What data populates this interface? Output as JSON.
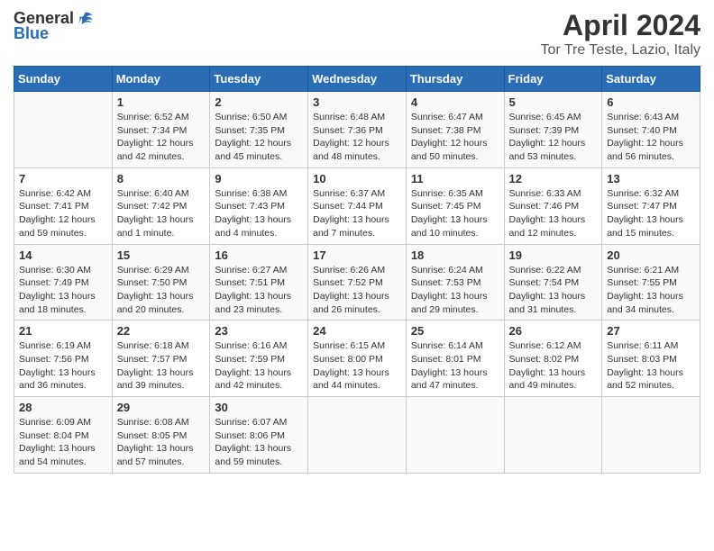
{
  "logo": {
    "general": "General",
    "blue": "Blue"
  },
  "title": "April 2024",
  "subtitle": "Tor Tre Teste, Lazio, Italy",
  "days_header": [
    "Sunday",
    "Monday",
    "Tuesday",
    "Wednesday",
    "Thursday",
    "Friday",
    "Saturday"
  ],
  "weeks": [
    [
      {
        "day": "",
        "info": ""
      },
      {
        "day": "1",
        "info": "Sunrise: 6:52 AM\nSunset: 7:34 PM\nDaylight: 12 hours\nand 42 minutes."
      },
      {
        "day": "2",
        "info": "Sunrise: 6:50 AM\nSunset: 7:35 PM\nDaylight: 12 hours\nand 45 minutes."
      },
      {
        "day": "3",
        "info": "Sunrise: 6:48 AM\nSunset: 7:36 PM\nDaylight: 12 hours\nand 48 minutes."
      },
      {
        "day": "4",
        "info": "Sunrise: 6:47 AM\nSunset: 7:38 PM\nDaylight: 12 hours\nand 50 minutes."
      },
      {
        "day": "5",
        "info": "Sunrise: 6:45 AM\nSunset: 7:39 PM\nDaylight: 12 hours\nand 53 minutes."
      },
      {
        "day": "6",
        "info": "Sunrise: 6:43 AM\nSunset: 7:40 PM\nDaylight: 12 hours\nand 56 minutes."
      }
    ],
    [
      {
        "day": "7",
        "info": "Sunrise: 6:42 AM\nSunset: 7:41 PM\nDaylight: 12 hours\nand 59 minutes."
      },
      {
        "day": "8",
        "info": "Sunrise: 6:40 AM\nSunset: 7:42 PM\nDaylight: 13 hours\nand 1 minute."
      },
      {
        "day": "9",
        "info": "Sunrise: 6:38 AM\nSunset: 7:43 PM\nDaylight: 13 hours\nand 4 minutes."
      },
      {
        "day": "10",
        "info": "Sunrise: 6:37 AM\nSunset: 7:44 PM\nDaylight: 13 hours\nand 7 minutes."
      },
      {
        "day": "11",
        "info": "Sunrise: 6:35 AM\nSunset: 7:45 PM\nDaylight: 13 hours\nand 10 minutes."
      },
      {
        "day": "12",
        "info": "Sunrise: 6:33 AM\nSunset: 7:46 PM\nDaylight: 13 hours\nand 12 minutes."
      },
      {
        "day": "13",
        "info": "Sunrise: 6:32 AM\nSunset: 7:47 PM\nDaylight: 13 hours\nand 15 minutes."
      }
    ],
    [
      {
        "day": "14",
        "info": "Sunrise: 6:30 AM\nSunset: 7:49 PM\nDaylight: 13 hours\nand 18 minutes."
      },
      {
        "day": "15",
        "info": "Sunrise: 6:29 AM\nSunset: 7:50 PM\nDaylight: 13 hours\nand 20 minutes."
      },
      {
        "day": "16",
        "info": "Sunrise: 6:27 AM\nSunset: 7:51 PM\nDaylight: 13 hours\nand 23 minutes."
      },
      {
        "day": "17",
        "info": "Sunrise: 6:26 AM\nSunset: 7:52 PM\nDaylight: 13 hours\nand 26 minutes."
      },
      {
        "day": "18",
        "info": "Sunrise: 6:24 AM\nSunset: 7:53 PM\nDaylight: 13 hours\nand 29 minutes."
      },
      {
        "day": "19",
        "info": "Sunrise: 6:22 AM\nSunset: 7:54 PM\nDaylight: 13 hours\nand 31 minutes."
      },
      {
        "day": "20",
        "info": "Sunrise: 6:21 AM\nSunset: 7:55 PM\nDaylight: 13 hours\nand 34 minutes."
      }
    ],
    [
      {
        "day": "21",
        "info": "Sunrise: 6:19 AM\nSunset: 7:56 PM\nDaylight: 13 hours\nand 36 minutes."
      },
      {
        "day": "22",
        "info": "Sunrise: 6:18 AM\nSunset: 7:57 PM\nDaylight: 13 hours\nand 39 minutes."
      },
      {
        "day": "23",
        "info": "Sunrise: 6:16 AM\nSunset: 7:59 PM\nDaylight: 13 hours\nand 42 minutes."
      },
      {
        "day": "24",
        "info": "Sunrise: 6:15 AM\nSunset: 8:00 PM\nDaylight: 13 hours\nand 44 minutes."
      },
      {
        "day": "25",
        "info": "Sunrise: 6:14 AM\nSunset: 8:01 PM\nDaylight: 13 hours\nand 47 minutes."
      },
      {
        "day": "26",
        "info": "Sunrise: 6:12 AM\nSunset: 8:02 PM\nDaylight: 13 hours\nand 49 minutes."
      },
      {
        "day": "27",
        "info": "Sunrise: 6:11 AM\nSunset: 8:03 PM\nDaylight: 13 hours\nand 52 minutes."
      }
    ],
    [
      {
        "day": "28",
        "info": "Sunrise: 6:09 AM\nSunset: 8:04 PM\nDaylight: 13 hours\nand 54 minutes."
      },
      {
        "day": "29",
        "info": "Sunrise: 6:08 AM\nSunset: 8:05 PM\nDaylight: 13 hours\nand 57 minutes."
      },
      {
        "day": "30",
        "info": "Sunrise: 6:07 AM\nSunset: 8:06 PM\nDaylight: 13 hours\nand 59 minutes."
      },
      {
        "day": "",
        "info": ""
      },
      {
        "day": "",
        "info": ""
      },
      {
        "day": "",
        "info": ""
      },
      {
        "day": "",
        "info": ""
      }
    ]
  ]
}
